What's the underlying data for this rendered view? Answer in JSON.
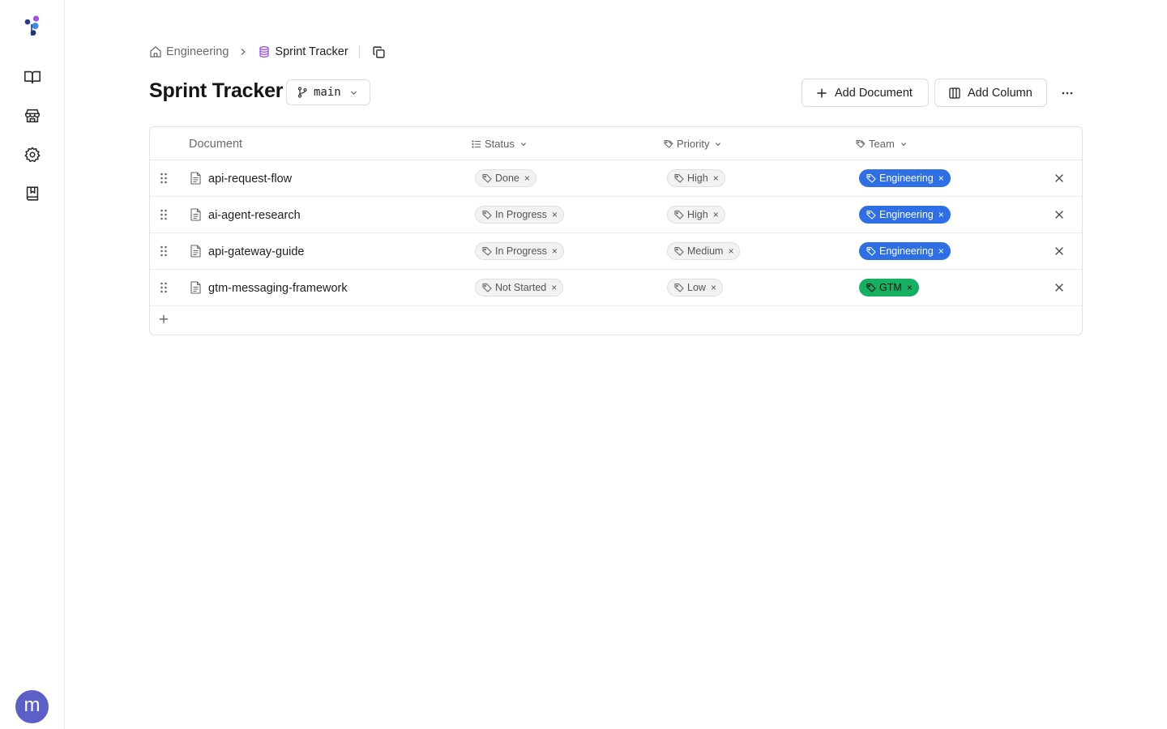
{
  "sidebar": {
    "items": [
      {
        "icon": "book-open-icon"
      },
      {
        "icon": "store-icon"
      },
      {
        "icon": "gear-icon"
      },
      {
        "icon": "bookmark-book-icon"
      }
    ],
    "avatar_initial": "m"
  },
  "breadcrumb": {
    "parent": "Engineering",
    "current": "Sprint Tracker"
  },
  "header": {
    "title": "Sprint Tracker",
    "branch": "main",
    "add_document_label": "Add Document",
    "add_column_label": "Add Column"
  },
  "table": {
    "columns": {
      "document": "Document",
      "status": "Status",
      "priority": "Priority",
      "team": "Team"
    },
    "rows": [
      {
        "name": "api-request-flow",
        "status": "Done",
        "priority": "High",
        "team": "Engineering",
        "team_color": "#2f6fe6"
      },
      {
        "name": "ai-agent-research",
        "status": "In Progress",
        "priority": "High",
        "team": "Engineering",
        "team_color": "#2f6fe6"
      },
      {
        "name": "api-gateway-guide",
        "status": "In Progress",
        "priority": "Medium",
        "team": "Engineering",
        "team_color": "#2f6fe6"
      },
      {
        "name": "gtm-messaging-framework",
        "status": "Not Started",
        "priority": "Low",
        "team": "GTM",
        "team_color": "#16b063"
      }
    ]
  }
}
